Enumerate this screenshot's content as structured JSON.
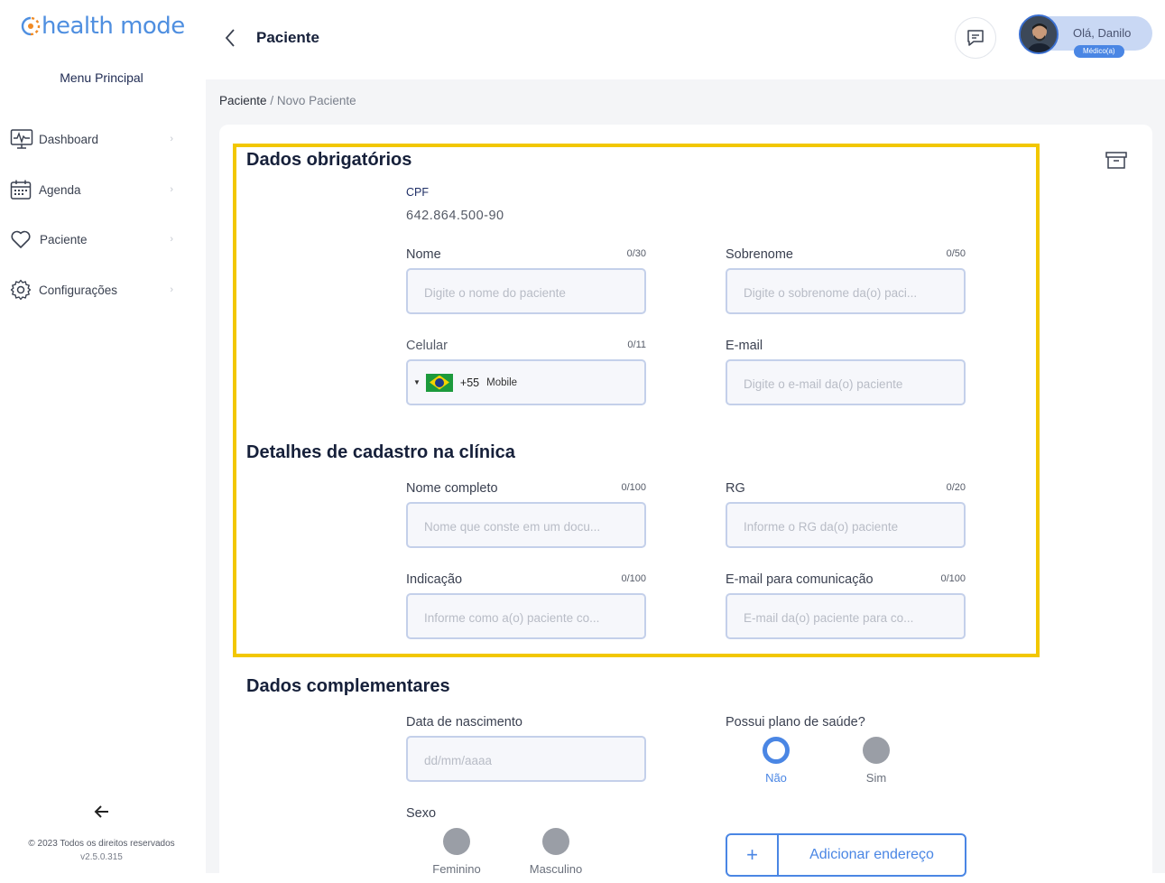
{
  "sidebar": {
    "logo_text": "health mode",
    "menu_title": "Menu Principal",
    "items": [
      {
        "label": "Dashboard",
        "icon": "monitor-icon"
      },
      {
        "label": "Agenda",
        "icon": "calendar-icon"
      },
      {
        "label": "Paciente",
        "icon": "heart-icon"
      },
      {
        "label": "Configurações",
        "icon": "gear-icon"
      }
    ],
    "copyright": "© 2023 Todos os direitos reservados",
    "version": "v2.5.0.315"
  },
  "header": {
    "title": "Paciente",
    "user_greeting": "Olá, Danilo",
    "user_role": "Médico(a)"
  },
  "breadcrumb": {
    "root": "Paciente",
    "separator": "/",
    "current": "Novo Paciente"
  },
  "form": {
    "section_required": "Dados obrigatórios",
    "cpf": {
      "label": "CPF",
      "value": "642.864.500-90"
    },
    "nome": {
      "label": "Nome",
      "counter": "0/30",
      "placeholder": "Digite o nome do paciente"
    },
    "sobrenome": {
      "label": "Sobrenome",
      "counter": "0/50",
      "placeholder": "Digite o sobrenome da(o) paci..."
    },
    "celular": {
      "label": "Celular",
      "counter": "0/11",
      "dial_code": "+55",
      "type": "Mobile"
    },
    "email": {
      "label": "E-mail",
      "placeholder": "Digite o e-mail da(o) paciente"
    },
    "section_clinic": "Detalhes de cadastro na clínica",
    "nome_completo": {
      "label": "Nome completo",
      "counter": "0/100",
      "placeholder": "Nome que conste em um docu..."
    },
    "rg": {
      "label": "RG",
      "counter": "0/20",
      "placeholder": "Informe o RG da(o) paciente"
    },
    "indicacao": {
      "label": "Indicação",
      "counter": "0/100",
      "placeholder": "Informe como a(o) paciente co..."
    },
    "email_comunicacao": {
      "label": "E-mail para comunicação",
      "counter": "0/100",
      "placeholder": "E-mail da(o) paciente para co..."
    },
    "section_complementary": "Dados complementares",
    "nascimento": {
      "label": "Data de nascimento",
      "placeholder": "dd/mm/aaaa"
    },
    "plano_saude": {
      "label": "Possui plano de saúde?",
      "options": [
        "Não",
        "Sim"
      ],
      "selected": "Não"
    },
    "sexo": {
      "label": "Sexo",
      "options": [
        "Feminino",
        "Masculino"
      ]
    },
    "add_address": {
      "plus": "+",
      "label": "Adicionar endereço"
    }
  },
  "colors": {
    "accent": "#4a86e4",
    "highlight": "#f2c700",
    "background": "#f4f5f7"
  }
}
